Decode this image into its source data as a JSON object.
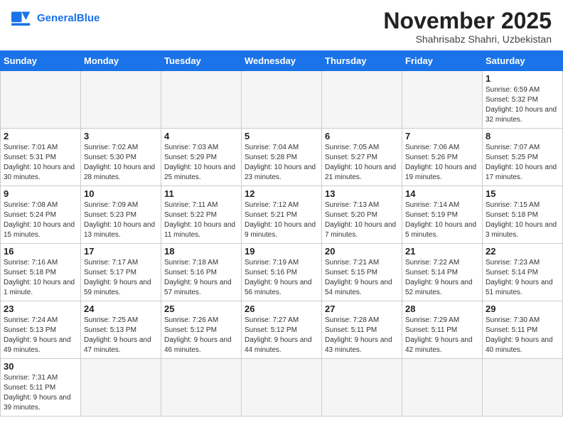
{
  "header": {
    "logo_general": "General",
    "logo_blue": "Blue",
    "month_title": "November 2025",
    "subtitle": "Shahrisabz Shahri, Uzbekistan"
  },
  "weekdays": [
    "Sunday",
    "Monday",
    "Tuesday",
    "Wednesday",
    "Thursday",
    "Friday",
    "Saturday"
  ],
  "weeks": [
    [
      null,
      null,
      null,
      null,
      null,
      null,
      {
        "day": "1",
        "sunrise": "6:59 AM",
        "sunset": "5:32 PM",
        "daylight": "10 hours and 32 minutes."
      }
    ],
    [
      {
        "day": "2",
        "sunrise": "7:01 AM",
        "sunset": "5:31 PM",
        "daylight": "10 hours and 30 minutes."
      },
      {
        "day": "3",
        "sunrise": "7:02 AM",
        "sunset": "5:30 PM",
        "daylight": "10 hours and 28 minutes."
      },
      {
        "day": "4",
        "sunrise": "7:03 AM",
        "sunset": "5:29 PM",
        "daylight": "10 hours and 25 minutes."
      },
      {
        "day": "5",
        "sunrise": "7:04 AM",
        "sunset": "5:28 PM",
        "daylight": "10 hours and 23 minutes."
      },
      {
        "day": "6",
        "sunrise": "7:05 AM",
        "sunset": "5:27 PM",
        "daylight": "10 hours and 21 minutes."
      },
      {
        "day": "7",
        "sunrise": "7:06 AM",
        "sunset": "5:26 PM",
        "daylight": "10 hours and 19 minutes."
      },
      {
        "day": "8",
        "sunrise": "7:07 AM",
        "sunset": "5:25 PM",
        "daylight": "10 hours and 17 minutes."
      }
    ],
    [
      {
        "day": "9",
        "sunrise": "7:08 AM",
        "sunset": "5:24 PM",
        "daylight": "10 hours and 15 minutes."
      },
      {
        "day": "10",
        "sunrise": "7:09 AM",
        "sunset": "5:23 PM",
        "daylight": "10 hours and 13 minutes."
      },
      {
        "day": "11",
        "sunrise": "7:11 AM",
        "sunset": "5:22 PM",
        "daylight": "10 hours and 11 minutes."
      },
      {
        "day": "12",
        "sunrise": "7:12 AM",
        "sunset": "5:21 PM",
        "daylight": "10 hours and 9 minutes."
      },
      {
        "day": "13",
        "sunrise": "7:13 AM",
        "sunset": "5:20 PM",
        "daylight": "10 hours and 7 minutes."
      },
      {
        "day": "14",
        "sunrise": "7:14 AM",
        "sunset": "5:19 PM",
        "daylight": "10 hours and 5 minutes."
      },
      {
        "day": "15",
        "sunrise": "7:15 AM",
        "sunset": "5:18 PM",
        "daylight": "10 hours and 3 minutes."
      }
    ],
    [
      {
        "day": "16",
        "sunrise": "7:16 AM",
        "sunset": "5:18 PM",
        "daylight": "10 hours and 1 minute."
      },
      {
        "day": "17",
        "sunrise": "7:17 AM",
        "sunset": "5:17 PM",
        "daylight": "9 hours and 59 minutes."
      },
      {
        "day": "18",
        "sunrise": "7:18 AM",
        "sunset": "5:16 PM",
        "daylight": "9 hours and 57 minutes."
      },
      {
        "day": "19",
        "sunrise": "7:19 AM",
        "sunset": "5:16 PM",
        "daylight": "9 hours and 56 minutes."
      },
      {
        "day": "20",
        "sunrise": "7:21 AM",
        "sunset": "5:15 PM",
        "daylight": "9 hours and 54 minutes."
      },
      {
        "day": "21",
        "sunrise": "7:22 AM",
        "sunset": "5:14 PM",
        "daylight": "9 hours and 52 minutes."
      },
      {
        "day": "22",
        "sunrise": "7:23 AM",
        "sunset": "5:14 PM",
        "daylight": "9 hours and 51 minutes."
      }
    ],
    [
      {
        "day": "23",
        "sunrise": "7:24 AM",
        "sunset": "5:13 PM",
        "daylight": "9 hours and 49 minutes."
      },
      {
        "day": "24",
        "sunrise": "7:25 AM",
        "sunset": "5:13 PM",
        "daylight": "9 hours and 47 minutes."
      },
      {
        "day": "25",
        "sunrise": "7:26 AM",
        "sunset": "5:12 PM",
        "daylight": "9 hours and 46 minutes."
      },
      {
        "day": "26",
        "sunrise": "7:27 AM",
        "sunset": "5:12 PM",
        "daylight": "9 hours and 44 minutes."
      },
      {
        "day": "27",
        "sunrise": "7:28 AM",
        "sunset": "5:11 PM",
        "daylight": "9 hours and 43 minutes."
      },
      {
        "day": "28",
        "sunrise": "7:29 AM",
        "sunset": "5:11 PM",
        "daylight": "9 hours and 42 minutes."
      },
      {
        "day": "29",
        "sunrise": "7:30 AM",
        "sunset": "5:11 PM",
        "daylight": "9 hours and 40 minutes."
      }
    ],
    [
      {
        "day": "30",
        "sunrise": "7:31 AM",
        "sunset": "5:11 PM",
        "daylight": "9 hours and 39 minutes."
      },
      null,
      null,
      null,
      null,
      null,
      null
    ]
  ]
}
